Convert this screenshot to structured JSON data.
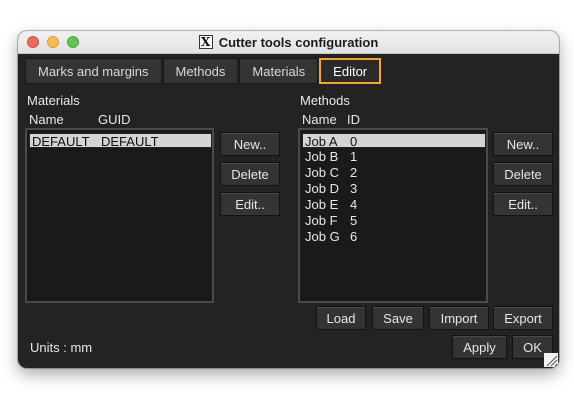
{
  "window": {
    "title": "Cutter tools configuration"
  },
  "tabs": [
    {
      "label": "Marks and margins",
      "active": false
    },
    {
      "label": "Methods",
      "active": false
    },
    {
      "label": "Materials",
      "active": false
    },
    {
      "label": "Editor",
      "active": true
    }
  ],
  "materials": {
    "section_label": "Materials",
    "columns": [
      "Name",
      "GUID"
    ],
    "rows": [
      {
        "name": "DEFAULT",
        "guid": "DEFAULT",
        "selected": true
      }
    ],
    "buttons": {
      "new": "New..",
      "delete": "Delete",
      "edit": "Edit.."
    }
  },
  "methods": {
    "section_label": "Methods",
    "columns": [
      "Name",
      "ID"
    ],
    "rows": [
      {
        "name": "Job A",
        "id": "0",
        "selected": true
      },
      {
        "name": "Job B",
        "id": "1"
      },
      {
        "name": "Job C",
        "id": "2"
      },
      {
        "name": "Job D",
        "id": "3"
      },
      {
        "name": "Job E",
        "id": "4"
      },
      {
        "name": "Job F",
        "id": "5"
      },
      {
        "name": "Job G",
        "id": "6"
      }
    ],
    "buttons": {
      "new": "New..",
      "delete": "Delete",
      "edit": "Edit.."
    }
  },
  "bottom_buttons": {
    "load": "Load",
    "save": "Save",
    "import": "Import",
    "export": "Export"
  },
  "footer": {
    "units": "Units : mm",
    "apply": "Apply",
    "ok": "OK"
  },
  "colors": {
    "accent": "#f5a623",
    "background": "#232323",
    "list_bg": "#1a1a1a"
  }
}
